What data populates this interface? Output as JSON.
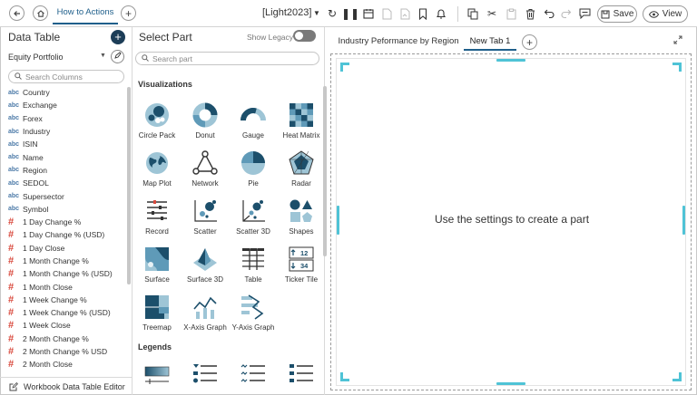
{
  "topbar": {
    "back_icon": "arrow-left-icon",
    "home_icon": "home-icon",
    "active_tab": "How to Actions",
    "add_tab_icon": "plus-icon",
    "workbook_title": "[Light2023]",
    "save_label": "Save",
    "view_label": "View"
  },
  "data_table": {
    "title": "Data Table",
    "source": "Equity Portfolio",
    "search_placeholder": "Search Columns",
    "columns": [
      {
        "type": "abc",
        "name": "Country"
      },
      {
        "type": "abc",
        "name": "Exchange"
      },
      {
        "type": "abc",
        "name": "Forex"
      },
      {
        "type": "abc",
        "name": "Industry"
      },
      {
        "type": "abc",
        "name": "ISIN"
      },
      {
        "type": "abc",
        "name": "Name"
      },
      {
        "type": "abc",
        "name": "Region"
      },
      {
        "type": "abc",
        "name": "SEDOL"
      },
      {
        "type": "abc",
        "name": "Supersector"
      },
      {
        "type": "abc",
        "name": "Symbol"
      },
      {
        "type": "#",
        "name": "1 Day Change %"
      },
      {
        "type": "#",
        "name": "1 Day Change % (USD)"
      },
      {
        "type": "#",
        "name": "1 Day Close"
      },
      {
        "type": "#",
        "name": "1 Month Change %"
      },
      {
        "type": "#",
        "name": "1 Month Change % (USD)"
      },
      {
        "type": "#",
        "name": "1 Month Close"
      },
      {
        "type": "#",
        "name": "1 Week Change %"
      },
      {
        "type": "#",
        "name": "1 Week Change % (USD)"
      },
      {
        "type": "#",
        "name": "1 Week Close"
      },
      {
        "type": "#",
        "name": "2 Month Change %"
      },
      {
        "type": "#",
        "name": "2 Month Change % USD"
      },
      {
        "type": "#",
        "name": "2 Month Close"
      }
    ],
    "footer_label": "Workbook Data Table Editor"
  },
  "select_part": {
    "title": "Select Part",
    "show_legacy_label": "Show Legacy",
    "search_placeholder": "Search part",
    "visualizations_heading": "Visualizations",
    "parts": [
      "Circle Pack",
      "Donut",
      "Gauge",
      "Heat Matrix",
      "Map Plot",
      "Network",
      "Pie",
      "Radar",
      "Record",
      "Scatter",
      "Scatter 3D",
      "Shapes",
      "Surface",
      "Surface 3D",
      "Table",
      "Ticker Tile",
      "Treemap",
      "X-Axis Graph",
      "Y-Axis Graph"
    ],
    "ticker_up": "12",
    "ticker_down": "34",
    "legends_heading": "Legends"
  },
  "workspace": {
    "tabs": [
      "Industry Peformance by Region",
      "New Tab 1"
    ],
    "empty_message": "Use the settings to create a part"
  },
  "colors": {
    "accent": "#1f5f8b",
    "icon_dark": "#1c4f6b",
    "icon_light": "#9ec5d6",
    "canvas_guides": "#4fc3d6",
    "numeric_type": "#d94a3e",
    "text_type": "#4c7aa8"
  }
}
